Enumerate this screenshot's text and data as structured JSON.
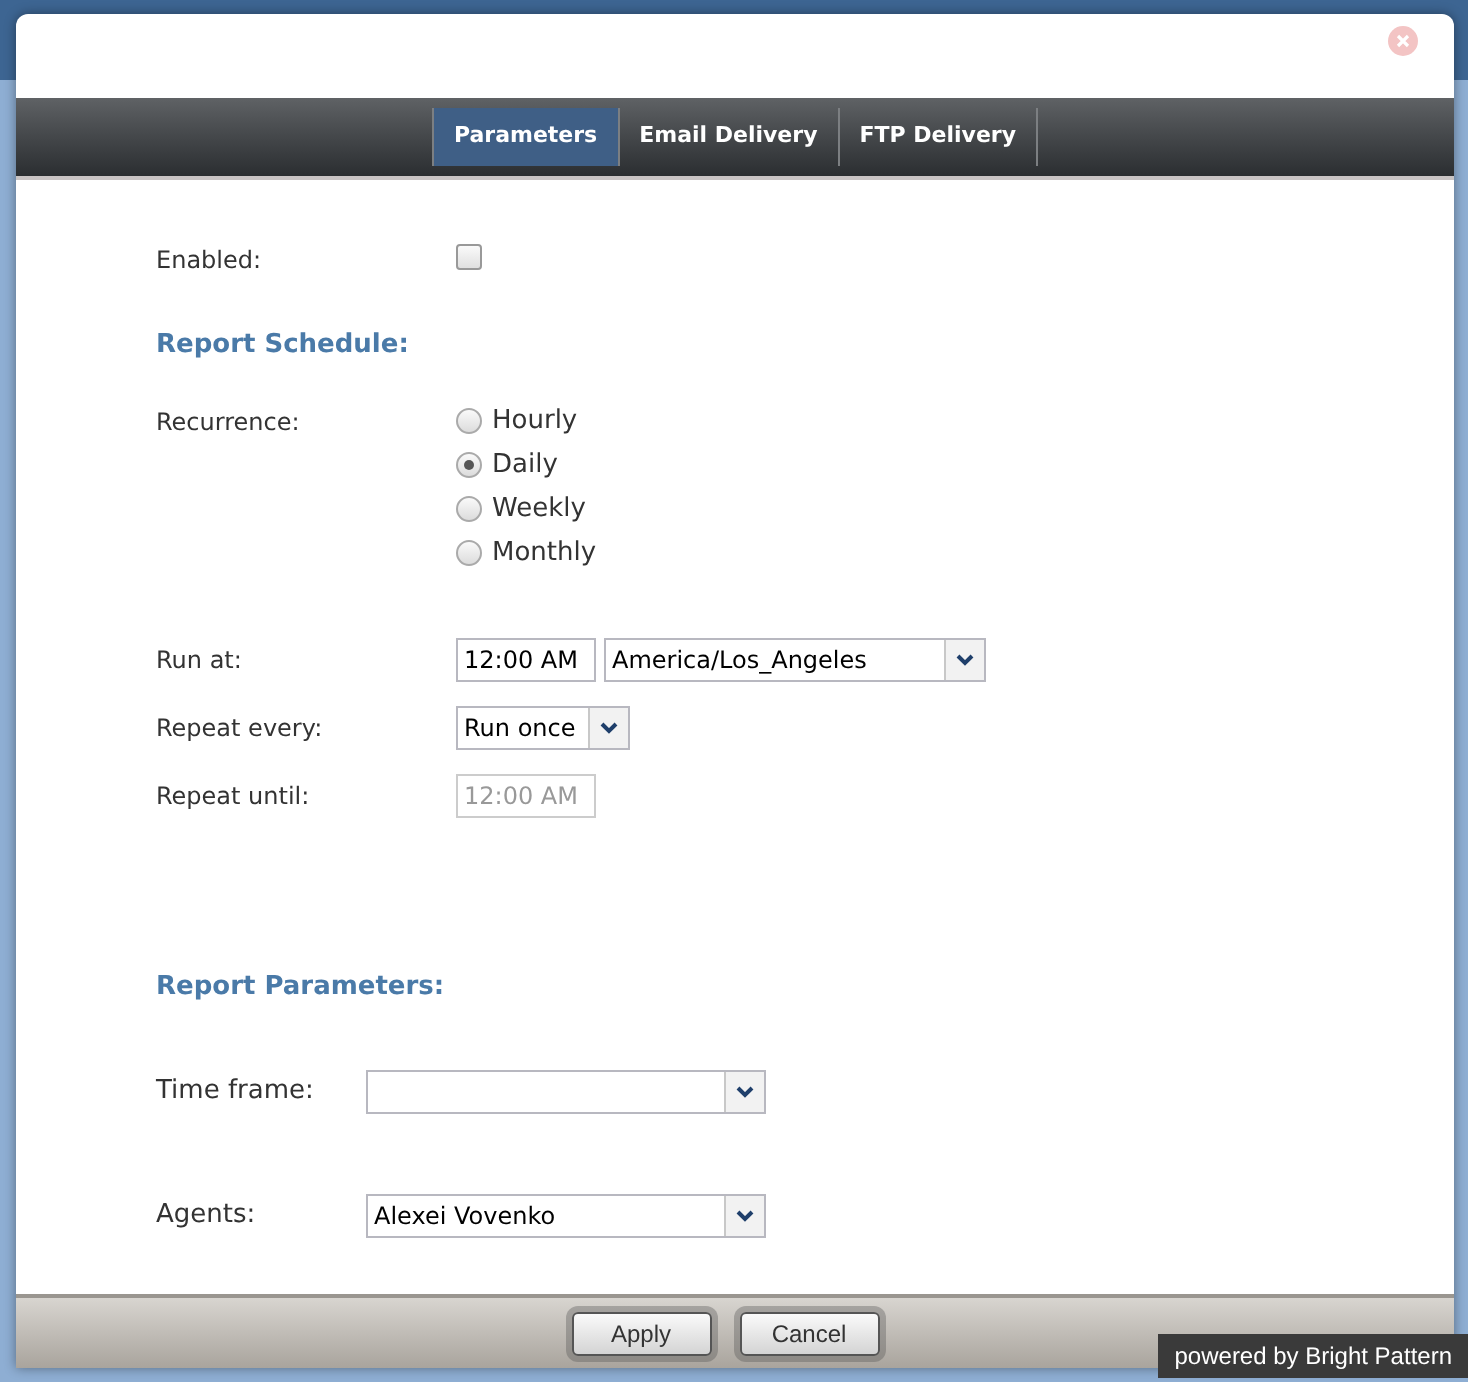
{
  "tabs": [
    {
      "label": "Parameters",
      "selected": true
    },
    {
      "label": "Email Delivery",
      "selected": false
    },
    {
      "label": "FTP Delivery",
      "selected": false
    }
  ],
  "enabled": {
    "label": "Enabled:",
    "checked": false
  },
  "schedule": {
    "heading": "Report Schedule:",
    "recurrence_label": "Recurrence:",
    "options": [
      {
        "label": "Hourly",
        "selected": false
      },
      {
        "label": "Daily",
        "selected": true
      },
      {
        "label": "Weekly",
        "selected": false
      },
      {
        "label": "Monthly",
        "selected": false
      }
    ],
    "run_at_label": "Run at:",
    "run_at_time": "12:00 AM",
    "timezone": "America/Los_Angeles",
    "repeat_every_label": "Repeat every:",
    "repeat_every": "Run once",
    "repeat_until_label": "Repeat until:",
    "repeat_until": "12:00 AM",
    "repeat_until_disabled": true
  },
  "parameters": {
    "heading": "Report Parameters:",
    "fields": [
      {
        "label": "Time frame:"
      },
      {
        "label": "Agents:",
        "value": "Alexei Vovenko"
      }
    ]
  },
  "buttons": [
    "Apply",
    "Cancel"
  ],
  "badge": "powered by Bright Pattern"
}
